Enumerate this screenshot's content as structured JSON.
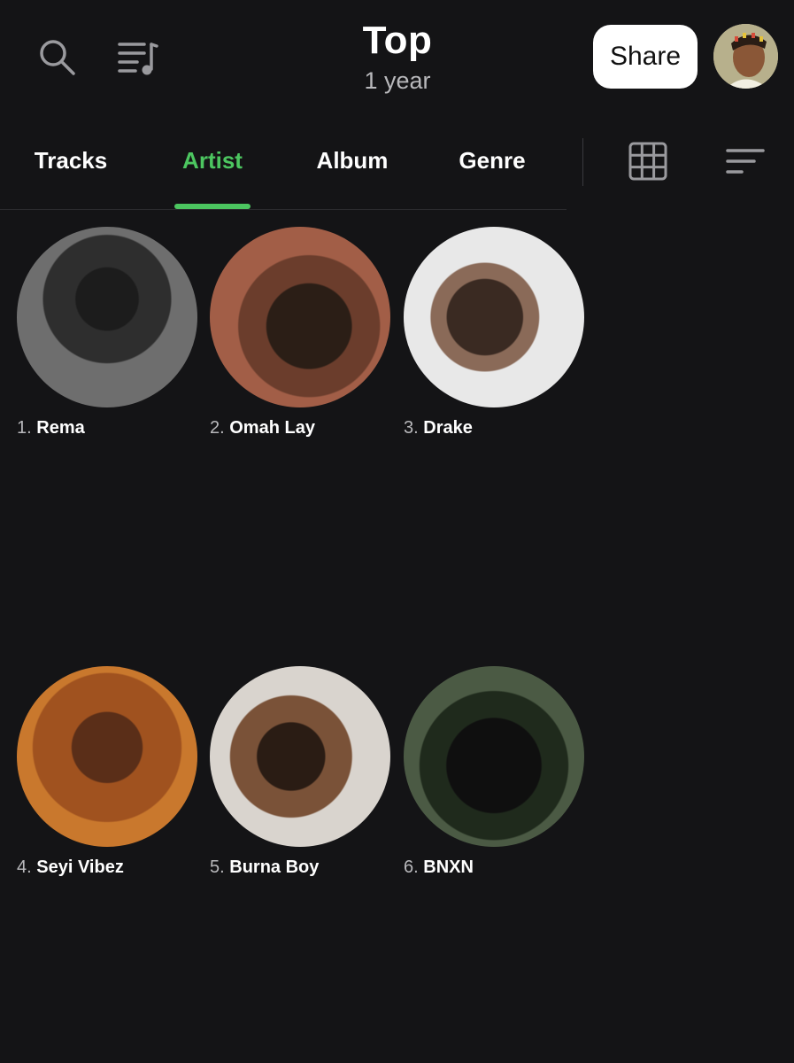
{
  "header": {
    "title": "Top",
    "subtitle": "1 year",
    "share_label": "Share",
    "icons": [
      "search-icon",
      "playlist-icon"
    ]
  },
  "tabs": [
    {
      "label": "Tracks",
      "active": false
    },
    {
      "label": "Artist",
      "active": true
    },
    {
      "label": "Album",
      "active": false
    },
    {
      "label": "Genre",
      "active": false
    }
  ],
  "toolbar": {
    "icons": [
      "grid-view-icon",
      "sort-icon"
    ]
  },
  "colors": {
    "background": "#141416",
    "accent": "#4cc660",
    "share_bg": "#ffffff",
    "muted_text": "#b9b9bc"
  },
  "artists": [
    {
      "rank": "1.",
      "name": "Rema"
    },
    {
      "rank": "2.",
      "name": "Omah Lay"
    },
    {
      "rank": "3.",
      "name": "Drake"
    },
    {
      "rank": "4.",
      "name": "Seyi Vibez"
    },
    {
      "rank": "5.",
      "name": "Burna Boy"
    },
    {
      "rank": "6.",
      "name": "BNXN"
    }
  ]
}
